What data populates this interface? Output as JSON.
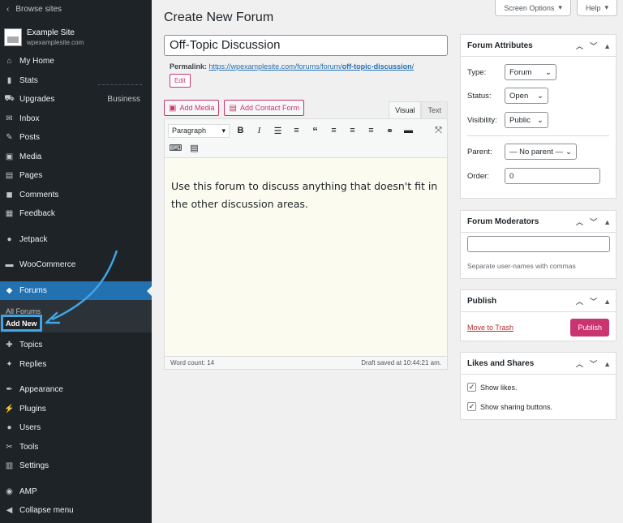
{
  "sidebar": {
    "browse_sites": "Browse sites",
    "site_name": "Example Site",
    "site_domain": "wpexamplesite.com",
    "items": [
      {
        "label": "My Home",
        "icon": "home-icon"
      },
      {
        "label": "Stats",
        "icon": "stats-icon"
      },
      {
        "label": "Upgrades",
        "icon": "cart-icon",
        "badge": "Business"
      },
      {
        "label": "Inbox",
        "icon": "mail-icon"
      },
      {
        "label": "Posts",
        "icon": "pin-icon"
      },
      {
        "label": "Media",
        "icon": "media-icon"
      },
      {
        "label": "Pages",
        "icon": "pages-icon"
      },
      {
        "label": "Comments",
        "icon": "comment-icon"
      },
      {
        "label": "Feedback",
        "icon": "feedback-icon"
      },
      {
        "label": "Jetpack",
        "icon": "jetpack-icon"
      },
      {
        "label": "WooCommerce",
        "icon": "woo-icon"
      },
      {
        "label": "Forums",
        "icon": "forums-icon"
      },
      {
        "label": "Topics",
        "icon": "topics-icon"
      },
      {
        "label": "Replies",
        "icon": "replies-icon"
      },
      {
        "label": "Appearance",
        "icon": "brush-icon"
      },
      {
        "label": "Plugins",
        "icon": "plug-icon"
      },
      {
        "label": "Users",
        "icon": "user-icon"
      },
      {
        "label": "Tools",
        "icon": "wrench-icon"
      },
      {
        "label": "Settings",
        "icon": "settings-icon"
      },
      {
        "label": "AMP",
        "icon": "amp-icon"
      },
      {
        "label": "Collapse menu",
        "icon": "collapse-icon"
      }
    ],
    "forums_sub": [
      "All Forums",
      "Add New"
    ]
  },
  "header": {
    "screen_options": "Screen Options",
    "help": "Help",
    "title": "Create New Forum"
  },
  "post": {
    "title_value": "Off-Topic Discussion",
    "permalink_label": "Permalink:",
    "permalink_base": "https://wpexamplesite.com/forums/forum/",
    "permalink_slug": "off-topic-discussion",
    "permalink_end": "/",
    "edit_label": "Edit"
  },
  "editor": {
    "add_media": "Add Media",
    "add_contact_form": "Add Contact Form",
    "tab_visual": "Visual",
    "tab_text": "Text",
    "format_select": "Paragraph",
    "content": "Use this forum to discuss anything that doesn't fit in the other discussion areas.",
    "word_count": "Word count: 14",
    "draft_saved": "Draft saved at 10:44:21 am."
  },
  "attributes": {
    "title": "Forum Attributes",
    "type_label": "Type:",
    "type_value": "Forum",
    "status_label": "Status:",
    "status_value": "Open",
    "visibility_label": "Visibility:",
    "visibility_value": "Public",
    "parent_label": "Parent:",
    "parent_value": "— No parent —",
    "order_label": "Order:",
    "order_value": "0"
  },
  "moderators": {
    "title": "Forum Moderators",
    "hint": "Separate user-names with commas"
  },
  "publish": {
    "title": "Publish",
    "trash": "Move to Trash",
    "button": "Publish"
  },
  "likes": {
    "title": "Likes and Shares",
    "show_likes": "Show likes.",
    "show_sharing": "Show sharing buttons."
  },
  "colors": {
    "sidebar_bg": "#1d2327",
    "active_menu": "#2271b1",
    "accent_pink": "#c9356e",
    "highlight_blue": "#3ea6e6"
  }
}
